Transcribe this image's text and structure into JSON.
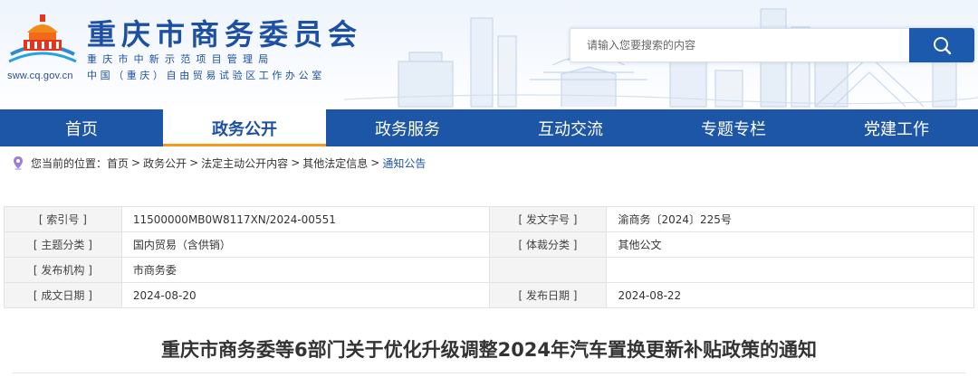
{
  "header": {
    "org_name": "重庆市商务委员会",
    "org_sub1": "重庆市中新示范项目管理局",
    "org_sub2": "中国（重庆）自由贸易试验区工作办公室",
    "domain": "sww.cq.gov.cn",
    "logo_icon": "great-hall-logo-icon",
    "search": {
      "placeholder": "请输入您要搜索的内容",
      "value": "",
      "icon": "search-icon"
    }
  },
  "nav": {
    "items": [
      {
        "label": "首页",
        "active": false
      },
      {
        "label": "政务公开",
        "active": true
      },
      {
        "label": "政务服务",
        "active": false
      },
      {
        "label": "互动交流",
        "active": false
      },
      {
        "label": "专题专栏",
        "active": false
      },
      {
        "label": "党建工作",
        "active": false
      }
    ]
  },
  "breadcrumb": {
    "prefix": "您当前的位置：",
    "items": [
      "首页",
      "政务公开",
      "法定主动公开内容",
      "其他法定信息",
      "通知公告"
    ],
    "separator": ">",
    "icon": "location-pin-icon"
  },
  "info": {
    "rows": [
      {
        "l1": "[ 索引号 ]",
        "v1": "11500000MB0W8117XN/2024-00551",
        "l2": "[ 发文字号 ]",
        "v2": "渝商务〔2024〕225号"
      },
      {
        "l1": "[ 主题分类 ]",
        "v1": "国内贸易（含供销）",
        "l2": "[ 体裁分类 ]",
        "v2": "其他公文"
      },
      {
        "l1": "[ 发布机构 ]",
        "v1": "市商务委",
        "l2": "",
        "v2": ""
      },
      {
        "l1": "[ 成文日期 ]",
        "v1": "2024-08-20",
        "l2": "[ 发布日期 ]",
        "v2": "2024-08-22"
      }
    ]
  },
  "document": {
    "title": "重庆市商务委等6部门关于优化升级调整2024年汽车置换更新补贴政策的通知"
  },
  "colors": {
    "brand_blue": "#1d56a6",
    "accent_orange": "#f39a1c"
  }
}
